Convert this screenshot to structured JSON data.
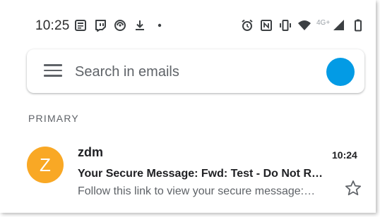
{
  "status_bar": {
    "time": "10:25",
    "network_label": "4G+",
    "left_icons": [
      "news-icon",
      "twitch-icon",
      "sync-icon",
      "download-icon",
      "dot-icon"
    ],
    "right_icons": [
      "alarm-icon",
      "nfc-icon",
      "vibrate-icon",
      "wifi-icon",
      "signal-icon",
      "battery-icon"
    ]
  },
  "search": {
    "placeholder": "Search in emails"
  },
  "colors": {
    "account_avatar": "#039be5",
    "sender_avatar": "#f9a825",
    "secondary_text": "#5f6368"
  },
  "section": {
    "label": "PRIMARY"
  },
  "emails": [
    {
      "avatar_letter": "Z",
      "sender": "zdm",
      "time": "10:24",
      "subject": "Your Secure Message: Fwd: Test - Do Not R…",
      "snippet": "Follow this link to view your secure message:…",
      "starred": false
    }
  ]
}
